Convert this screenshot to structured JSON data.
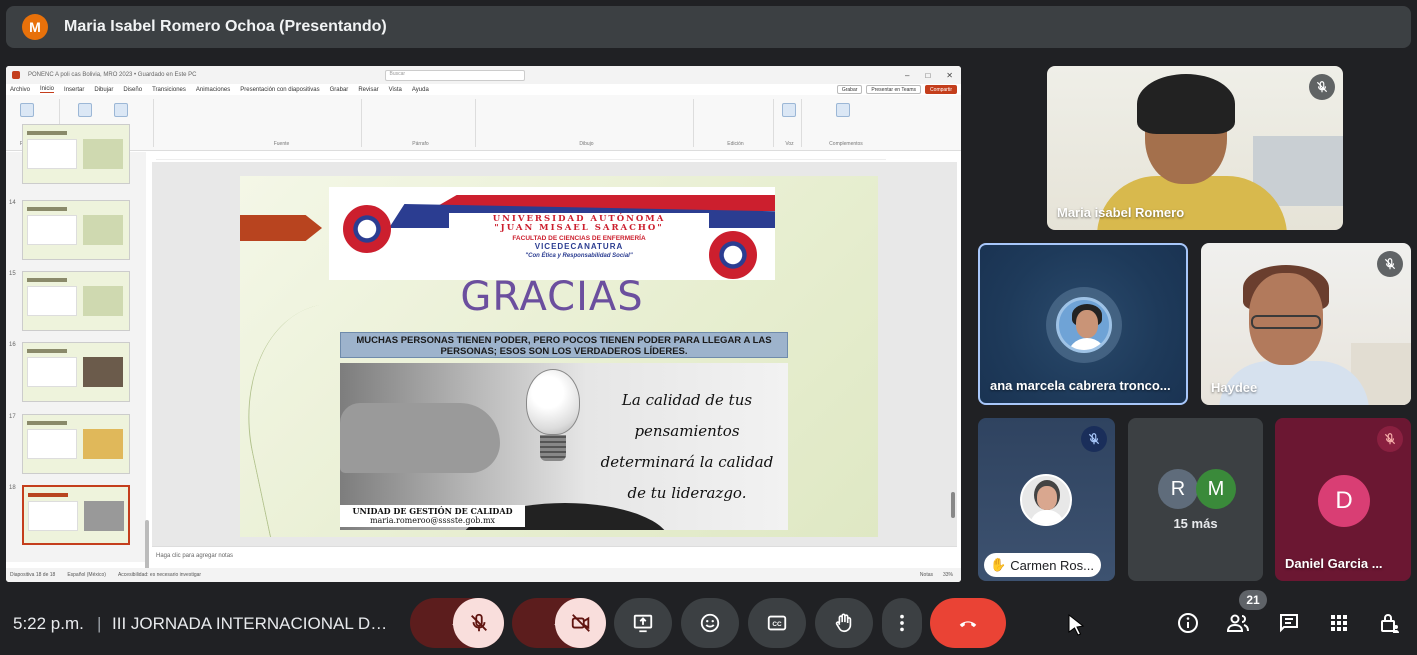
{
  "header": {
    "avatar_letter": "M",
    "presenter": "Maria Isabel Romero Ochoa (Presentando)"
  },
  "ppt": {
    "title": "PONENC A poli cas Bolivia, MRO 2023 • Guardado en Este PC",
    "search": "Buscar",
    "menu": [
      "Archivo",
      "Inicio",
      "Insertar",
      "Dibujar",
      "Diseño",
      "Transiciones",
      "Animaciones",
      "Presentación con diapositivas",
      "Grabar",
      "Revisar",
      "Vista",
      "Ayuda"
    ],
    "buttons": {
      "record": "Grabar",
      "present": "Presentar en Teams",
      "share": "Compartir"
    },
    "ribbon_groups": [
      "Portapapeles",
      "Diapositivas",
      "Fuente",
      "Párrafo",
      "Dibujo",
      "Edición",
      "Voz",
      "Complementos"
    ],
    "thumb_numbers": [
      "14",
      "15",
      "16",
      "17",
      "18"
    ],
    "notes_placeholder": "Haga clic para agregar notas",
    "status": "Diapositiva 18 de 18",
    "language": "Español (México)",
    "accessibility": "Accesibilidad: es necesario investigar",
    "notes_btn": "Notas",
    "zoom": "33%"
  },
  "slide": {
    "uni_line1": "UNIVERSIDAD AUTÓNOMA",
    "uni_line2": "\"JUAN MISAEL SARACHO\"",
    "faculty": "FACULTAD DE CIENCIAS DE ENFERMERÍA",
    "vice": "VICEDECANATURA",
    "motto": "\"Con Ética y Responsabilidad Social\"",
    "heading": "GRACIAS",
    "quote": "MUCHAS PERSONAS TIENEN PODER, PERO POCOS TIENEN PODER PARA LLEGAR A LAS PERSONAS; ESOS SON LOS VERDADEROS LÍDERES.",
    "script_text": "La calidad de tus pensamientos determinará la calidad de tu liderazgo.",
    "unit": "UNIDAD DE GESTIÓN DE CALIDAD",
    "email": "maria.romeroo@sssste.gob.mx"
  },
  "participants": {
    "maria": "Maria isabel Romero",
    "ana": "ana marcela cabrera tronco...",
    "haydee": "Haydee",
    "carmen": "Carmen Ros...",
    "more_initial_1": "R",
    "more_initial_2": "M",
    "more_count": "15 más",
    "daniel_initial": "D",
    "daniel": "Daniel Garcia ..."
  },
  "bottom": {
    "time": "5:22 p.m.",
    "separator": "|",
    "meeting": "III JORNADA INTERNACIONAL DE ENFERMERÍA",
    "people_count": "21"
  },
  "colors": {
    "meet_bg": "#202124",
    "hangup": "#ea4335",
    "muted_pill": "#f9dedc",
    "accent_ppt": "#c43e1c"
  }
}
